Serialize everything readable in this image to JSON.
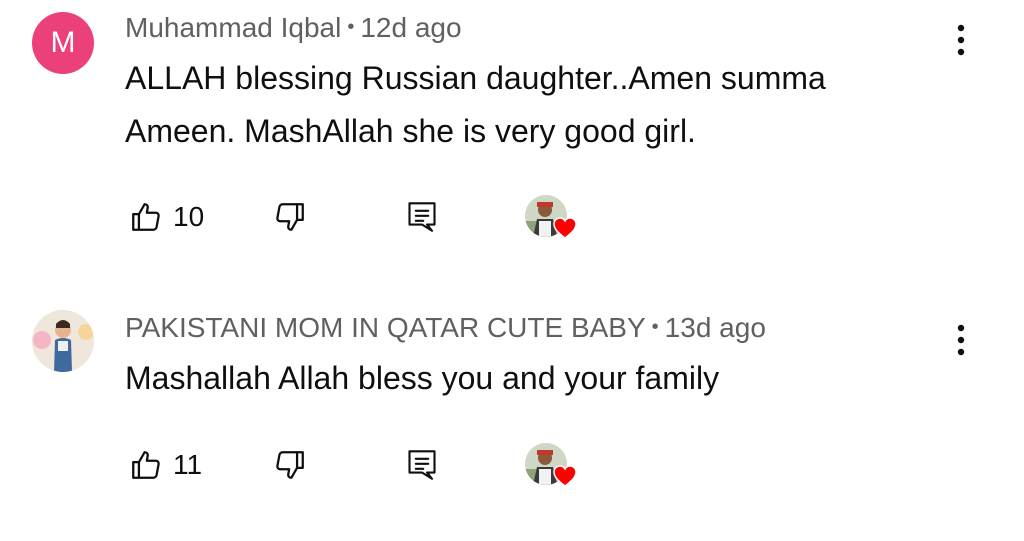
{
  "comments": [
    {
      "author": "Muhammad Iqbal",
      "time": "12d ago",
      "avatar_letter": "M",
      "text_lines": [
        "ALLAH blessing Russian daughter..Amen summa",
        "Ameen. MashAllah she is very good girl."
      ],
      "likes": "10"
    },
    {
      "author": "PAKISTANI MOM IN QATAR CUTE BABY",
      "time": "13d ago",
      "text_lines": [
        "Mashallah Allah bless you and your family"
      ],
      "likes": "11"
    }
  ],
  "separator": "•",
  "colors": {
    "avatar_pink": "#ec407a",
    "heart_red": "#ff0000",
    "meta_gray": "#606060"
  },
  "icons": {
    "like": "thumbs-up-icon",
    "dislike": "thumbs-down-icon",
    "reply": "reply-icon",
    "more": "more-vertical-icon",
    "creator_heart": "creator-heart-icon"
  }
}
